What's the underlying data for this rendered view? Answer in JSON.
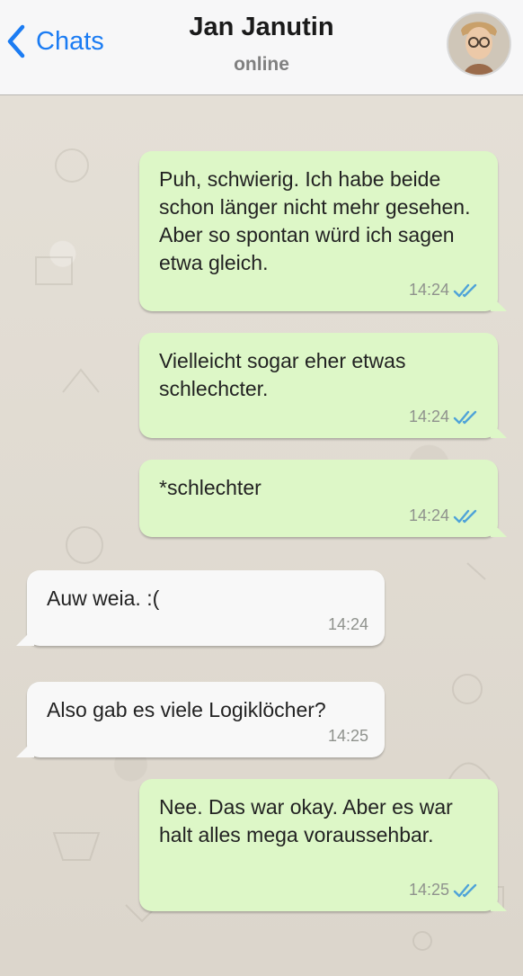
{
  "header": {
    "back_label": "Chats",
    "contact_name": "Jan Janutin",
    "status": "online"
  },
  "messages": [
    {
      "direction": "outgoing",
      "text": "Puh, schwierig. Ich habe beide schon länger nicht mehr gesehen. Aber so spontan würd ich sagen etwa gleich.",
      "time": "14:24",
      "read": true
    },
    {
      "direction": "outgoing",
      "text": "Vielleicht sogar eher etwas schlechcter.",
      "time": "14:24",
      "read": true
    },
    {
      "direction": "outgoing",
      "text": "*schlechter",
      "time": "14:24",
      "read": true
    },
    {
      "direction": "incoming",
      "text": "Auw weia. :(",
      "time": "14:24"
    },
    {
      "direction": "incoming",
      "text": "Also gab es viele Logiklöcher?",
      "time": "14:25"
    },
    {
      "direction": "outgoing",
      "text": "Nee. Das war okay. Aber es war halt alles mega voraussehbar.",
      "time": "14:25",
      "read": true
    }
  ],
  "colors": {
    "accent": "#1b7cf3",
    "outgoing_bubble": "#ddf7c7",
    "incoming_bubble": "#f8f8f8",
    "read_ticks": "#4fa3d8"
  }
}
